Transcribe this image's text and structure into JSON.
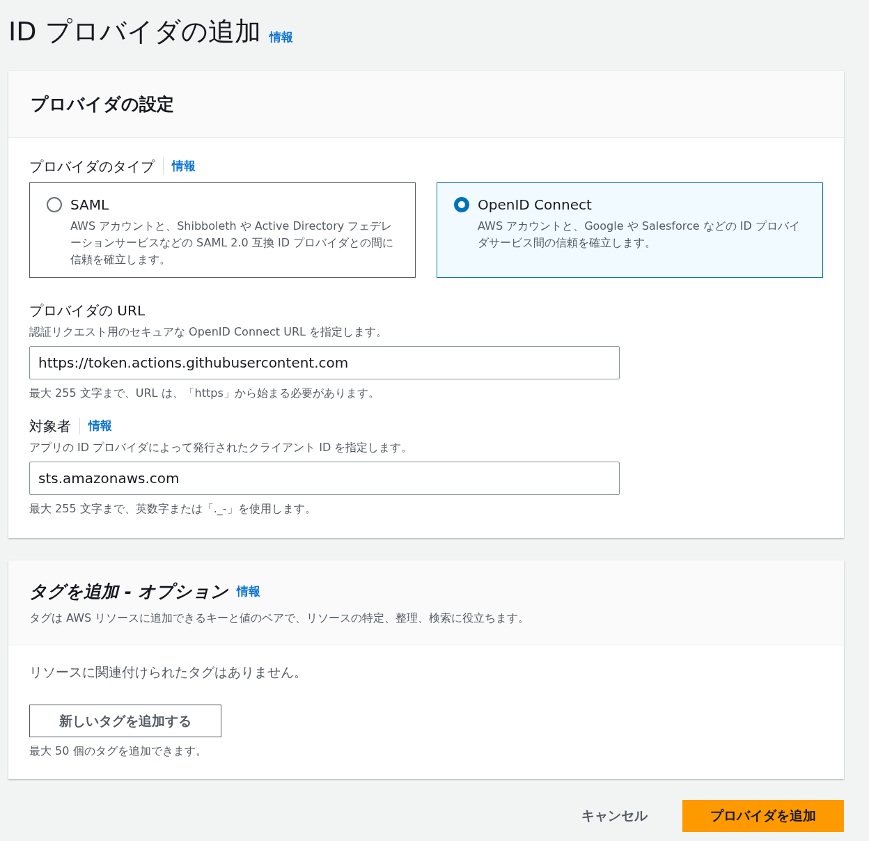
{
  "page": {
    "title": "ID プロバイダの追加",
    "info": "情報"
  },
  "provider_settings": {
    "title": "プロバイダの設定",
    "type_field": {
      "label": "プロバイダのタイプ",
      "info": "情報",
      "options": [
        {
          "label": "SAML",
          "description": "AWS アカウントと、Shibboleth や Active Directory フェデレーションサービスなどの SAML 2.0 互換 ID プロバイダとの間に信頼を確立します。",
          "selected": false
        },
        {
          "label": "OpenID Connect",
          "description": "AWS アカウントと、Google や Salesforce などの ID プロバイダサービス間の信頼を確立します。",
          "selected": true
        }
      ]
    },
    "url_field": {
      "label": "プロバイダの URL",
      "description": "認証リクエスト用のセキュアな OpenID Connect URL を指定します。",
      "value": "https://token.actions.githubusercontent.com",
      "constraint": "最大 255 文字まで、URL は、「https」から始まる必要があります。"
    },
    "audience_field": {
      "label": "対象者",
      "info": "情報",
      "description": "アプリの ID プロバイダによって発行されたクライアント ID を指定します。",
      "value": "sts.amazonaws.com",
      "constraint": "最大 255 文字まで、英数字または「._-」を使用します。"
    }
  },
  "tags": {
    "title": "タグを追加 - オプション",
    "info": "情報",
    "description": "タグは AWS リソースに追加できるキーと値のペアで、リソースの特定、整理、検索に役立ちます。",
    "empty_message": "リソースに関連付けられたタグはありません。",
    "add_button": "新しいタグを追加する",
    "limit_note": "最大 50 個のタグを追加できます。"
  },
  "actions": {
    "cancel": "キャンセル",
    "submit": "プロバイダを追加"
  }
}
